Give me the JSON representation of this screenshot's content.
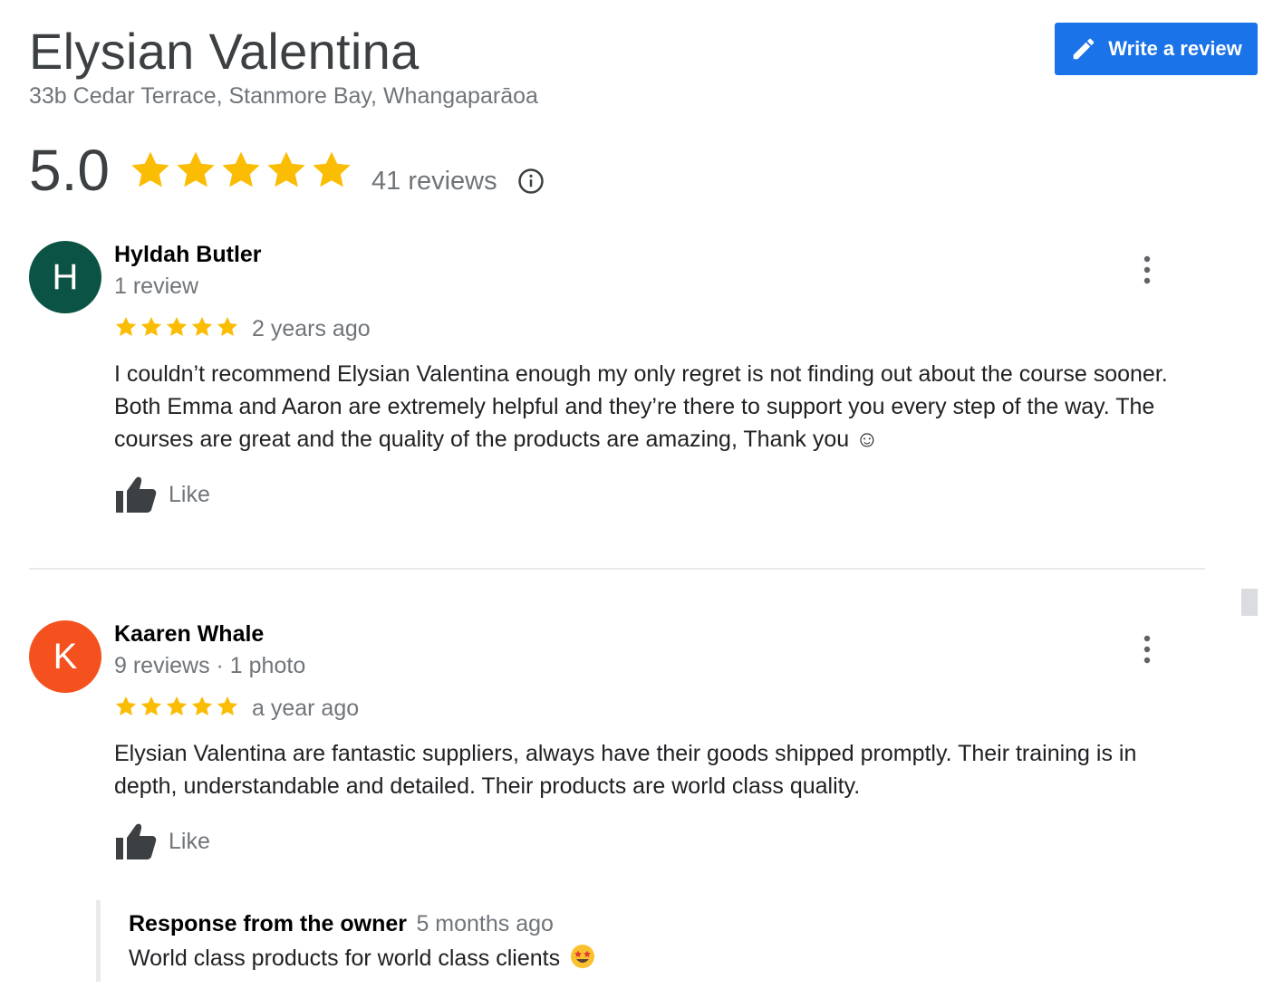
{
  "business": {
    "name": "Elysian Valentina",
    "address": "33b Cedar Terrace, Stanmore Bay, Whangaparāoa",
    "rating": "5.0",
    "review_count": "41 reviews",
    "write_review_label": "Write a review"
  },
  "colors": {
    "accent": "#1a73e8",
    "star": "#fbbc04",
    "secondary_text": "#70757a"
  },
  "icons": {
    "write": "pencil-icon",
    "info": "info-icon",
    "more": "more-vert-icon",
    "like": "thumbs-up-icon"
  },
  "reviews": [
    {
      "avatar_letter": "H",
      "avatar_color": "#0b5345",
      "name": "Hyldah Butler",
      "meta": "1 review",
      "rating": 5,
      "date": "2 years ago",
      "text": "I couldn’t recommend Elysian Valentina enough my only regret is not finding out about the course sooner. Both Emma and Aaron are extremely helpful and they’re there to support you every step of the way. The courses are great and the quality of the products are amazing, Thank you ☺",
      "like_label": "Like"
    },
    {
      "avatar_letter": "K",
      "avatar_color": "#f4511e",
      "name": "Kaaren Whale",
      "meta": "9 reviews · 1 photo",
      "rating": 5,
      "date": "a year ago",
      "text": "Elysian Valentina are fantastic suppliers, always have their goods shipped promptly. Their training is in depth, understandable and detailed. Their products are world class quality.",
      "like_label": "Like",
      "owner_response": {
        "title": "Response from the owner",
        "date": "5 months ago",
        "text": "World class products for world class clients"
      }
    }
  ]
}
